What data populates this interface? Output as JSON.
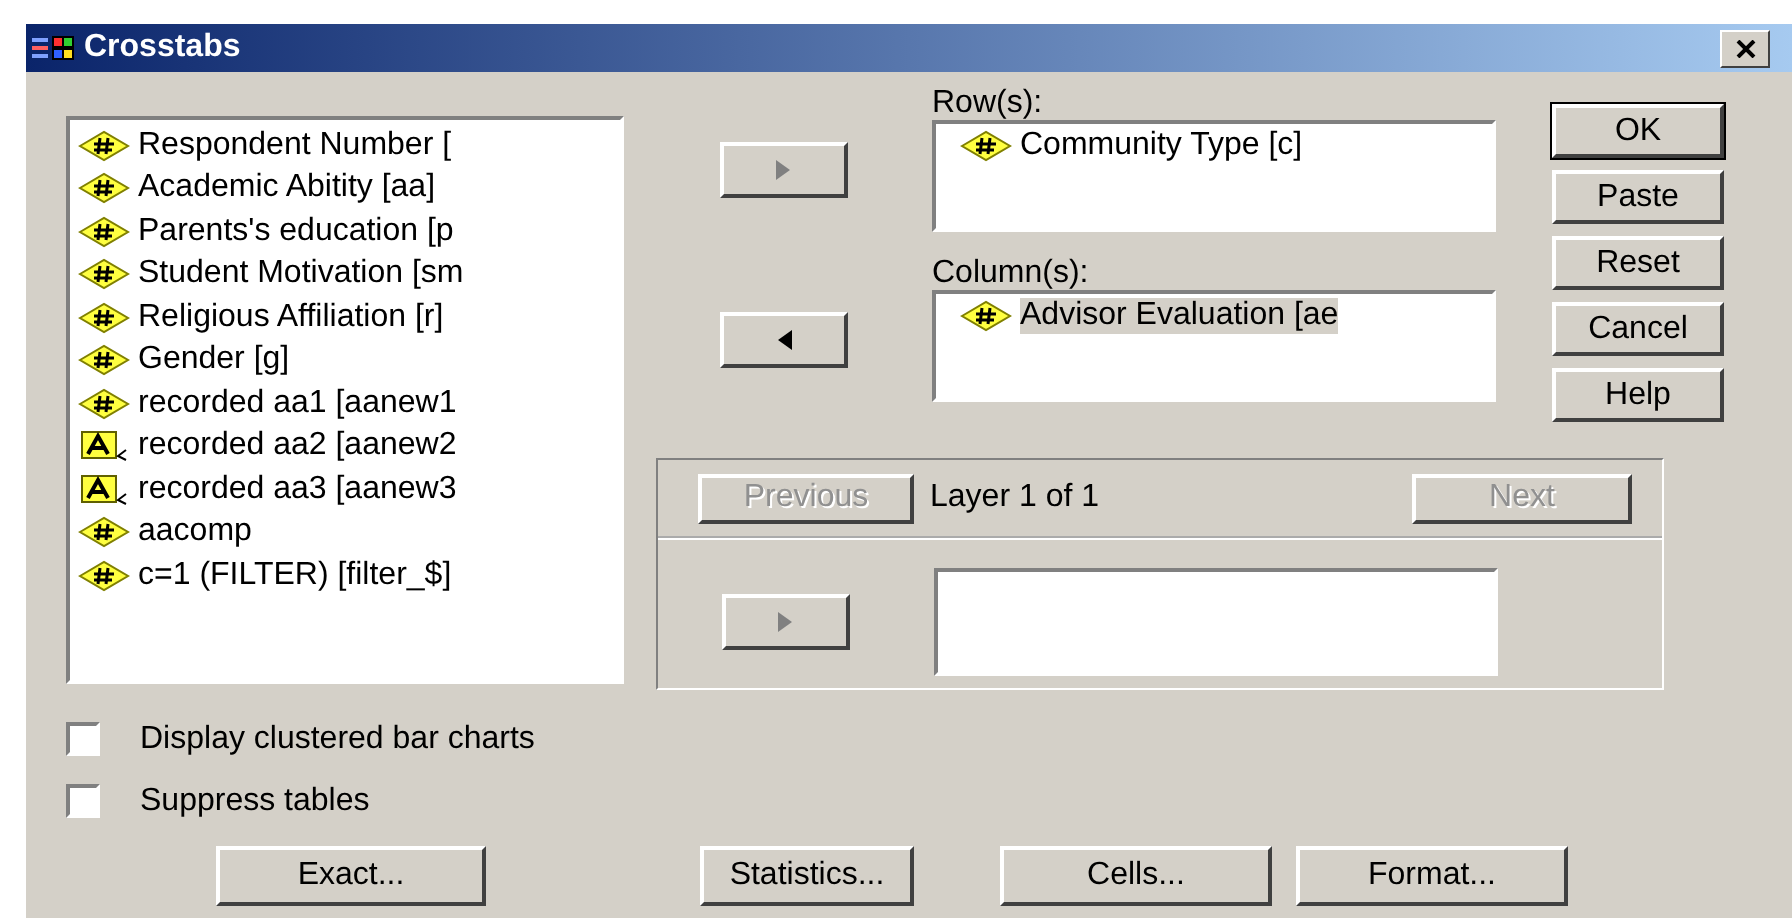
{
  "window": {
    "title": "Crosstabs"
  },
  "variables": [
    {
      "name": "Respondent Number [",
      "kind": "numeric"
    },
    {
      "name": "Academic Abitity [aa]",
      "kind": "numeric"
    },
    {
      "name": "Parents's education [p",
      "kind": "numeric"
    },
    {
      "name": "Student Motivation [sm",
      "kind": "numeric"
    },
    {
      "name": "Religious Affiliation [r]",
      "kind": "numeric"
    },
    {
      "name": "Gender [g]",
      "kind": "numeric"
    },
    {
      "name": "recorded aa1 [aanew1",
      "kind": "numeric"
    },
    {
      "name": "recorded aa2 [aanew2",
      "kind": "string"
    },
    {
      "name": "recorded aa3 [aanew3",
      "kind": "string"
    },
    {
      "name": "aacomp",
      "kind": "numeric"
    },
    {
      "name": "c=1 (FILTER) [filter_$]",
      "kind": "numeric"
    }
  ],
  "rows": {
    "label": "Row(s):",
    "move_button": {
      "kind": "right",
      "disabled": true
    },
    "items": [
      {
        "name": "Community Type [c]",
        "kind": "numeric",
        "selected": false
      }
    ]
  },
  "columns": {
    "label": "Column(s):",
    "move_button": {
      "kind": "left",
      "disabled": false
    },
    "items": [
      {
        "name": "Advisor Evaluation [ae",
        "kind": "numeric",
        "selected": true
      }
    ]
  },
  "layer": {
    "previous": {
      "label": "Previous",
      "disabled": true
    },
    "text": "Layer 1 of 1",
    "next": {
      "label": "Next",
      "disabled": true
    },
    "move_button": {
      "kind": "right",
      "disabled": true
    }
  },
  "action_buttons": [
    {
      "label": "OK",
      "default": true
    },
    {
      "label": "Paste",
      "default": false
    },
    {
      "label": "Reset",
      "default": false
    },
    {
      "label": "Cancel",
      "default": false
    },
    {
      "label": "Help",
      "default": false
    }
  ],
  "checkboxes": [
    {
      "label": "Display clustered bar charts",
      "checked": false
    },
    {
      "label": "Suppress tables",
      "checked": false
    }
  ],
  "bottom_buttons": [
    {
      "label": "Exact..."
    },
    {
      "label": "Statistics..."
    },
    {
      "label": "Cells..."
    },
    {
      "label": "Format..."
    }
  ]
}
